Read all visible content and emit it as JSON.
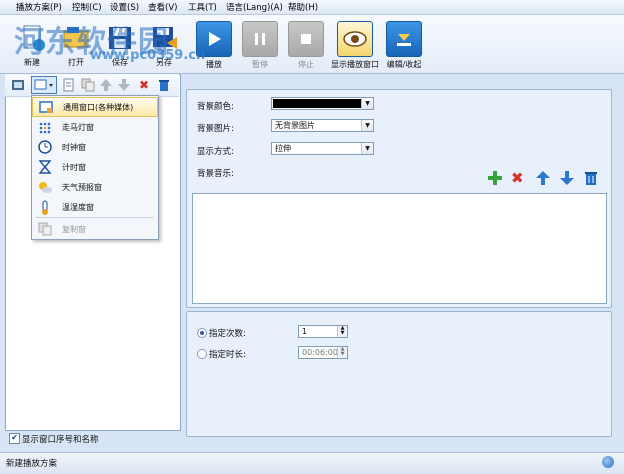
{
  "menu": [
    "播放方案(P)",
    "控制(C)",
    "设置(S)",
    "查看(V)",
    "工具(T)",
    "语言(Lang)(A)",
    "帮助(H)"
  ],
  "toolbar": {
    "watermark": "河东软件园",
    "watermark_url": "www.pc0359.cn",
    "items": [
      {
        "label": "新建",
        "icon": "new-icon"
      },
      {
        "label": "打开",
        "icon": "open-icon"
      },
      {
        "label": "保存",
        "icon": "save-icon"
      },
      {
        "label": "另存",
        "icon": "save-as-icon"
      },
      {
        "label": "播放",
        "icon": "play-icon"
      },
      {
        "label": "暂停",
        "icon": "pause-icon"
      },
      {
        "label": "停止",
        "icon": "stop-icon"
      },
      {
        "label": "显示播放窗口",
        "icon": "eye-icon"
      },
      {
        "label": "编辑/收起",
        "icon": "edit-collapse-icon"
      }
    ]
  },
  "dropdown": {
    "items": [
      {
        "label": "通用窗口(各种媒体)",
        "icon": "general-window-icon"
      },
      {
        "label": "走马灯窗",
        "icon": "marquee-icon"
      },
      {
        "label": "时钟窗",
        "icon": "clock-icon"
      },
      {
        "label": "计时窗",
        "icon": "hourglass-icon"
      },
      {
        "label": "天气预报窗",
        "icon": "weather-icon"
      },
      {
        "label": "温湿度窗",
        "icon": "thermometer-icon"
      },
      {
        "label": "复制窗",
        "icon": "copy-icon"
      }
    ]
  },
  "background": {
    "color_label": "背景颜色:",
    "color_value": "#000000",
    "image_label": "背景图片:",
    "image_value": "无背景图片",
    "mode_label": "显示方式:",
    "mode_value": "拉伸",
    "music_label": "背景音乐:"
  },
  "playback": {
    "times_label": "指定次数:",
    "times_value": "1",
    "duration_label": "指定时长:",
    "duration_value": "00:06:00"
  },
  "footer": {
    "checkbox_label": "显示窗口序号和名称",
    "status": "新建播放方案"
  },
  "colors": {
    "accent": "#2a6fc9",
    "panel_bg": "#e8f0fb",
    "delete_red": "#d9312c",
    "add_green": "#3aa23a"
  }
}
